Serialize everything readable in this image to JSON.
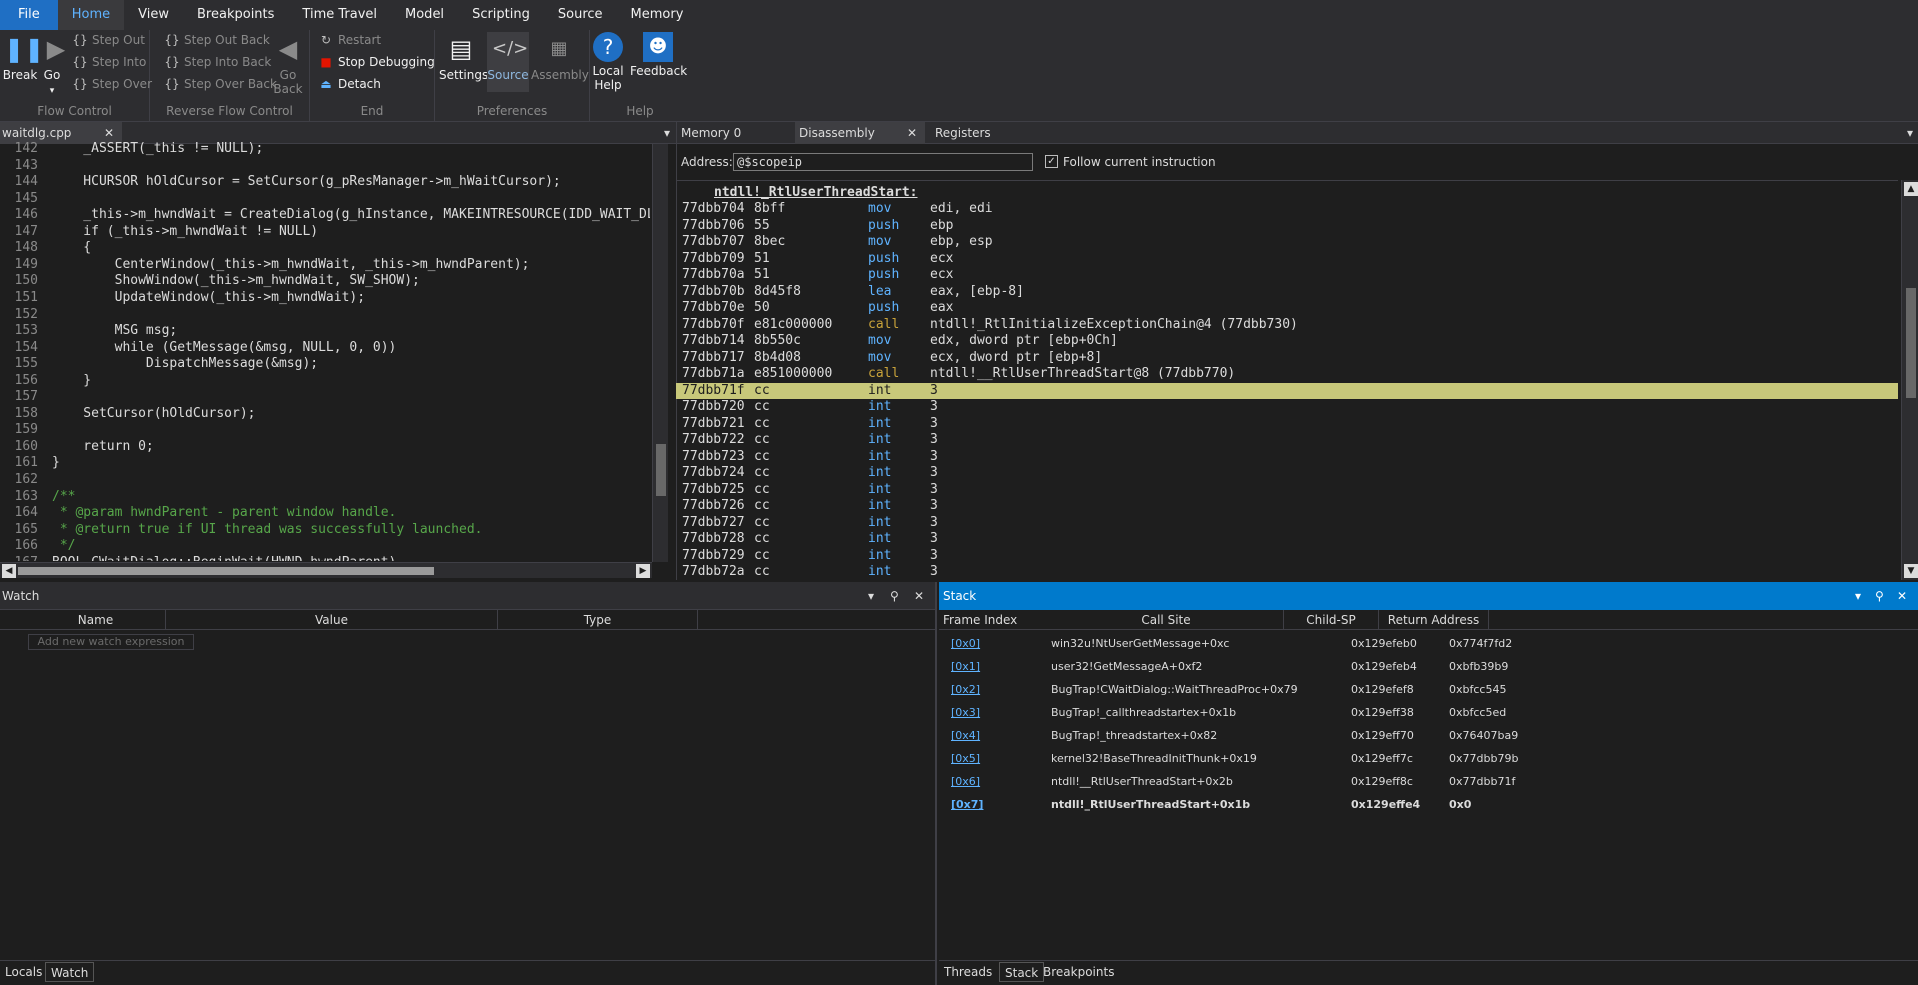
{
  "ribbon_tabs": [
    "File",
    "Home",
    "View",
    "Breakpoints",
    "Time Travel",
    "Model",
    "Scripting",
    "Source",
    "Memory"
  ],
  "ribbon": {
    "flow_control": {
      "label": "Flow Control",
      "break": "Break",
      "go": "Go",
      "step_out": "Step Out",
      "step_into": "Step Into",
      "step_over": "Step Over"
    },
    "reverse_flow": {
      "label": "Reverse Flow Control",
      "step_out_back": "Step Out Back",
      "step_into_back": "Step Into Back",
      "step_over_back": "Step Over Back",
      "go_back": "Go Back"
    },
    "end": {
      "label": "End",
      "restart": "Restart",
      "stop": "Stop Debugging",
      "detach": "Detach"
    },
    "preferences": {
      "label": "Preferences",
      "settings": "Settings",
      "source": "Source",
      "assembly": "Assembly"
    },
    "help": {
      "label": "Help",
      "local_help": "Local Help",
      "feedback": "Feedback"
    }
  },
  "source_panel": {
    "tab": "waitdlg.cpp",
    "lines": [
      {
        "n": "142",
        "t": "    _ASSERT(_this != NULL);"
      },
      {
        "n": "143",
        "t": ""
      },
      {
        "n": "144",
        "t": "    HCURSOR hOldCursor = SetCursor(g_pResManager->m_hWaitCursor);"
      },
      {
        "n": "145",
        "t": ""
      },
      {
        "n": "146",
        "t": "    _this->m_hwndWait = CreateDialog(g_hInstance, MAKEINTRESOURCE(IDD_WAIT_DLG"
      },
      {
        "n": "147",
        "t": "    if (_this->m_hwndWait != NULL)"
      },
      {
        "n": "148",
        "t": "    {"
      },
      {
        "n": "149",
        "t": "        CenterWindow(_this->m_hwndWait, _this->m_hwndParent);"
      },
      {
        "n": "150",
        "t": "        ShowWindow(_this->m_hwndWait, SW_SHOW);"
      },
      {
        "n": "151",
        "t": "        UpdateWindow(_this->m_hwndWait);"
      },
      {
        "n": "152",
        "t": ""
      },
      {
        "n": "153",
        "t": "        MSG msg;"
      },
      {
        "n": "154",
        "t": "        while (GetMessage(&msg, NULL, 0, 0))"
      },
      {
        "n": "155",
        "t": "            DispatchMessage(&msg);"
      },
      {
        "n": "156",
        "t": "    }"
      },
      {
        "n": "157",
        "t": ""
      },
      {
        "n": "158",
        "t": "    SetCursor(hOldCursor);"
      },
      {
        "n": "159",
        "t": ""
      },
      {
        "n": "160",
        "t": "    return 0;"
      },
      {
        "n": "161",
        "t": "}"
      },
      {
        "n": "162",
        "t": ""
      },
      {
        "n": "163",
        "t": "/**"
      },
      {
        "n": "164",
        "t": " * @param hwndParent - parent window handle."
      },
      {
        "n": "165",
        "t": " * @return true if UI thread was successfully launched."
      },
      {
        "n": "166",
        "t": " */"
      },
      {
        "n": "167",
        "t": "BOOL CWaitDialog::BeginWait(HWND hwndParent)"
      }
    ]
  },
  "disasm_panel": {
    "tabs": [
      "Memory 0",
      "Disassembly",
      "Registers"
    ],
    "address_label": "Address:",
    "address_value": "@$scopeip",
    "follow_label": "Follow current instruction",
    "symbol": "ntdll!_RtlUserThreadStart:",
    "rows": [
      {
        "a": "77dbb704",
        "b": "8bff",
        "m": "mov",
        "o": "edi, edi"
      },
      {
        "a": "77dbb706",
        "b": "55",
        "m": "push",
        "o": "ebp"
      },
      {
        "a": "77dbb707",
        "b": "8bec",
        "m": "mov",
        "o": "ebp, esp"
      },
      {
        "a": "77dbb709",
        "b": "51",
        "m": "push",
        "o": "ecx"
      },
      {
        "a": "77dbb70a",
        "b": "51",
        "m": "push",
        "o": "ecx"
      },
      {
        "a": "77dbb70b",
        "b": "8d45f8",
        "m": "lea",
        "o": "eax, [ebp-8]"
      },
      {
        "a": "77dbb70e",
        "b": "50",
        "m": "push",
        "o": "eax"
      },
      {
        "a": "77dbb70f",
        "b": "e81c000000",
        "m": "call",
        "o": "ntdll!_RtlInitializeExceptionChain@4 (77dbb730)"
      },
      {
        "a": "77dbb714",
        "b": "8b550c",
        "m": "mov",
        "o": "edx, dword ptr [ebp+0Ch]"
      },
      {
        "a": "77dbb717",
        "b": "8b4d08",
        "m": "mov",
        "o": "ecx, dword ptr [ebp+8]"
      },
      {
        "a": "77dbb71a",
        "b": "e851000000",
        "m": "call",
        "o": "ntdll!__RtlUserThreadStart@8 (77dbb770)"
      },
      {
        "a": "77dbb71f",
        "b": "cc",
        "m": "int",
        "o": "3"
      },
      {
        "a": "77dbb720",
        "b": "cc",
        "m": "int",
        "o": "3"
      },
      {
        "a": "77dbb721",
        "b": "cc",
        "m": "int",
        "o": "3"
      },
      {
        "a": "77dbb722",
        "b": "cc",
        "m": "int",
        "o": "3"
      },
      {
        "a": "77dbb723",
        "b": "cc",
        "m": "int",
        "o": "3"
      },
      {
        "a": "77dbb724",
        "b": "cc",
        "m": "int",
        "o": "3"
      },
      {
        "a": "77dbb725",
        "b": "cc",
        "m": "int",
        "o": "3"
      },
      {
        "a": "77dbb726",
        "b": "cc",
        "m": "int",
        "o": "3"
      },
      {
        "a": "77dbb727",
        "b": "cc",
        "m": "int",
        "o": "3"
      },
      {
        "a": "77dbb728",
        "b": "cc",
        "m": "int",
        "o": "3"
      },
      {
        "a": "77dbb729",
        "b": "cc",
        "m": "int",
        "o": "3"
      },
      {
        "a": "77dbb72a",
        "b": "cc",
        "m": "int",
        "o": "3"
      }
    ],
    "highlight_color": "#c8c87a"
  },
  "watch_panel": {
    "title": "Watch",
    "cols": [
      "Name",
      "Value",
      "Type"
    ],
    "placeholder": "Add new watch expression",
    "bottom_tabs": [
      "Locals",
      "Watch"
    ]
  },
  "stack_panel": {
    "title": "Stack",
    "cols": [
      "Frame Index",
      "Call Site",
      "Child-SP",
      "Return Address"
    ],
    "rows": [
      {
        "i": "[0x0]",
        "c": "win32u!NtUserGetMessage+0xc",
        "sp": "0x129efeb0",
        "r": "0x774f7fd2"
      },
      {
        "i": "[0x1]",
        "c": "user32!GetMessageA+0xf2",
        "sp": "0x129efeb4",
        "r": "0xbfb39b9"
      },
      {
        "i": "[0x2]",
        "c": "BugTrap!CWaitDialog::WaitThreadProc+0x79",
        "sp": "0x129efef8",
        "r": "0xbfcc545"
      },
      {
        "i": "[0x3]",
        "c": "BugTrap!_callthreadstartex+0x1b",
        "sp": "0x129eff38",
        "r": "0xbfcc5ed"
      },
      {
        "i": "[0x4]",
        "c": "BugTrap!_threadstartex+0x82",
        "sp": "0x129eff70",
        "r": "0x76407ba9"
      },
      {
        "i": "[0x5]",
        "c": "kernel32!BaseThreadInitThunk+0x19",
        "sp": "0x129eff7c",
        "r": "0x77dbb79b"
      },
      {
        "i": "[0x6]",
        "c": "ntdll!__RtlUserThreadStart+0x2b",
        "sp": "0x129eff8c",
        "r": "0x77dbb71f"
      },
      {
        "i": "[0x7]",
        "c": "ntdll!_RtlUserThreadStart+0x1b",
        "sp": "0x129effe4",
        "r": "0x0"
      }
    ],
    "bottom_tabs": [
      "Threads",
      "Stack",
      "Breakpoints"
    ],
    "accent": "#007acc"
  }
}
